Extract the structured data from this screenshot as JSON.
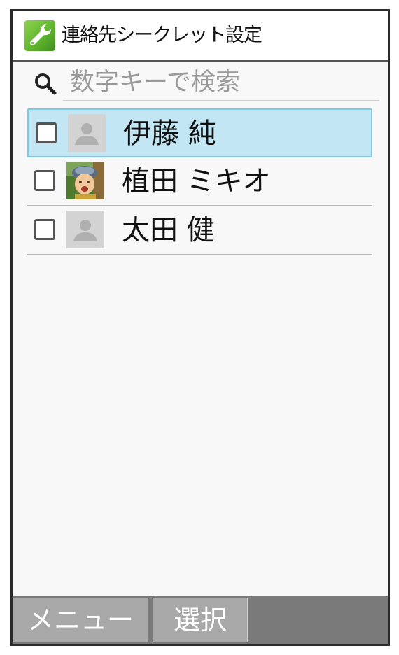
{
  "header": {
    "title": "連絡先シークレット設定",
    "icon": "wrench-icon"
  },
  "search": {
    "placeholder": "数字キーで検索",
    "value": "",
    "icon": "search-icon"
  },
  "contacts": [
    {
      "name": "伊藤 純",
      "checked": false,
      "selected": true,
      "avatar": "default-avatar-icon"
    },
    {
      "name": "植田 ミキオ",
      "checked": false,
      "selected": false,
      "avatar": "photo"
    },
    {
      "name": "太田 健",
      "checked": false,
      "selected": false,
      "avatar": "default-avatar-icon"
    }
  ],
  "softkeys": {
    "menu_label": "メニュー",
    "select_label": "選択"
  },
  "colors": {
    "selected_row": "#c3e6f5",
    "selected_border": "#79cbe6",
    "footer_bar": "#7a7a7a",
    "softkey": "#a8a8a8",
    "app_icon": "#5fb62e"
  }
}
